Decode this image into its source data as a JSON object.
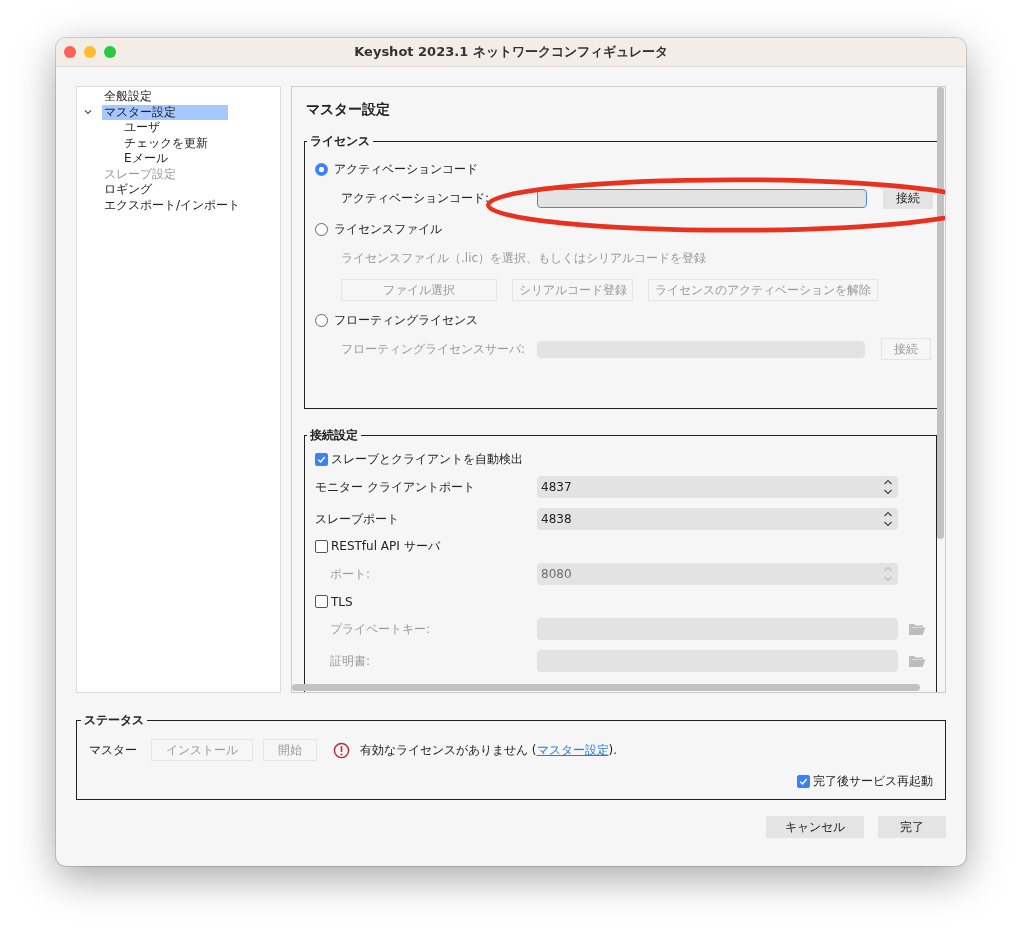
{
  "window": {
    "title": "Keyshot 2023.1 ネットワークコンフィギュレータ"
  },
  "sidebar": {
    "items": [
      {
        "label": "全般設定",
        "selected": false,
        "disabled": false
      },
      {
        "label": "マスター設定",
        "selected": true,
        "disabled": false,
        "expanded": true,
        "children": [
          {
            "label": "ユーザ",
            "selected": false,
            "disabled": false
          },
          {
            "label": "チェックを更新",
            "selected": false,
            "disabled": false
          },
          {
            "label": "Eメール",
            "selected": false,
            "disabled": false
          }
        ]
      },
      {
        "label": "スレーブ設定",
        "selected": false,
        "disabled": true
      },
      {
        "label": "ロギング",
        "selected": false,
        "disabled": false
      },
      {
        "label": "エクスポート/インポート",
        "selected": false,
        "disabled": false
      }
    ]
  },
  "page": {
    "title": "マスター設定"
  },
  "license": {
    "legend": "ライセンス",
    "options": [
      {
        "kind": "field",
        "label": "アクティベーションコード",
        "selected": true,
        "disabled": false,
        "field_label": "アクティベーションコード:",
        "button": "接続"
      },
      {
        "kind": "file",
        "label": "ライセンスファイル",
        "selected": false,
        "disabled": true,
        "description": "ライセンスファイル（.lic）を選択、もしくはシリアルコードを登録",
        "buttons": [
          "ファイル選択",
          "シリアルコード登録",
          "ライセンスのアクティベーションを解除"
        ]
      },
      {
        "kind": "field",
        "label": "フローティングライセンス",
        "selected": false,
        "disabled": true,
        "field_label": "フローティングライセンスサーバ:",
        "button": "接続"
      }
    ]
  },
  "connection": {
    "legend": "接続設定",
    "items": [
      {
        "kind": "checkbox",
        "label": "スレーブとクライアントを自動検出",
        "checked": true
      },
      {
        "kind": "spin",
        "label": "モニター クライアントポート",
        "value": "4837",
        "disabled": false
      },
      {
        "kind": "spin",
        "label": "スレーブポート",
        "value": "4838",
        "disabled": false
      },
      {
        "kind": "checkbox",
        "label": "RESTful API サーバ",
        "checked": false
      },
      {
        "kind": "spin",
        "label": "ポート:",
        "value": "8080",
        "disabled": true
      },
      {
        "kind": "checkbox",
        "label": "TLS",
        "checked": false
      },
      {
        "kind": "file",
        "label": "プライベートキー:",
        "disabled": true
      },
      {
        "kind": "file",
        "label": "証明書:",
        "disabled": true
      }
    ]
  },
  "status": {
    "legend": "ステータス",
    "label": "マスター",
    "buttons": [
      "インストール",
      "開始"
    ],
    "message": "有効なライセンスがありません (",
    "link": "マスター設定",
    "message_end": ").",
    "restart": {
      "label": "完了後サービス再起動",
      "checked": true
    }
  },
  "footer": {
    "buttons": [
      "キャンセル",
      "完了"
    ]
  }
}
